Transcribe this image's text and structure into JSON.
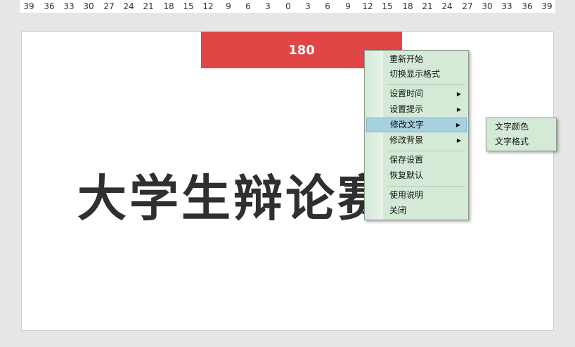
{
  "ruler": {
    "ticks": [
      "39",
      "36",
      "33",
      "30",
      "27",
      "24",
      "21",
      "18",
      "15",
      "12",
      "9",
      "6",
      "3",
      "0",
      "3",
      "6",
      "9",
      "12",
      "15",
      "18",
      "21",
      "24",
      "27",
      "30",
      "33",
      "36",
      "39"
    ]
  },
  "timer": {
    "value": "180"
  },
  "title": {
    "text": "大学生辩论赛"
  },
  "context_menu": {
    "items": [
      {
        "label": "重新开始"
      },
      {
        "label": "切换显示格式"
      },
      {
        "label": "设置时间"
      },
      {
        "label": "设置提示"
      },
      {
        "label": "修改文字"
      },
      {
        "label": "修改背景"
      },
      {
        "label": "保存设置"
      },
      {
        "label": "恢复默认"
      },
      {
        "label": "使用说明"
      },
      {
        "label": "关闭"
      }
    ],
    "submenu_arrow": "▶"
  },
  "submenu": {
    "items": [
      {
        "label": "文字颜色"
      },
      {
        "label": "文字格式"
      }
    ]
  },
  "colors": {
    "timer_bg": "#e04646",
    "menu_bg": "#d4ead7",
    "menu_highlight": "#a6d1de",
    "title_text": "#2f2f2f"
  }
}
